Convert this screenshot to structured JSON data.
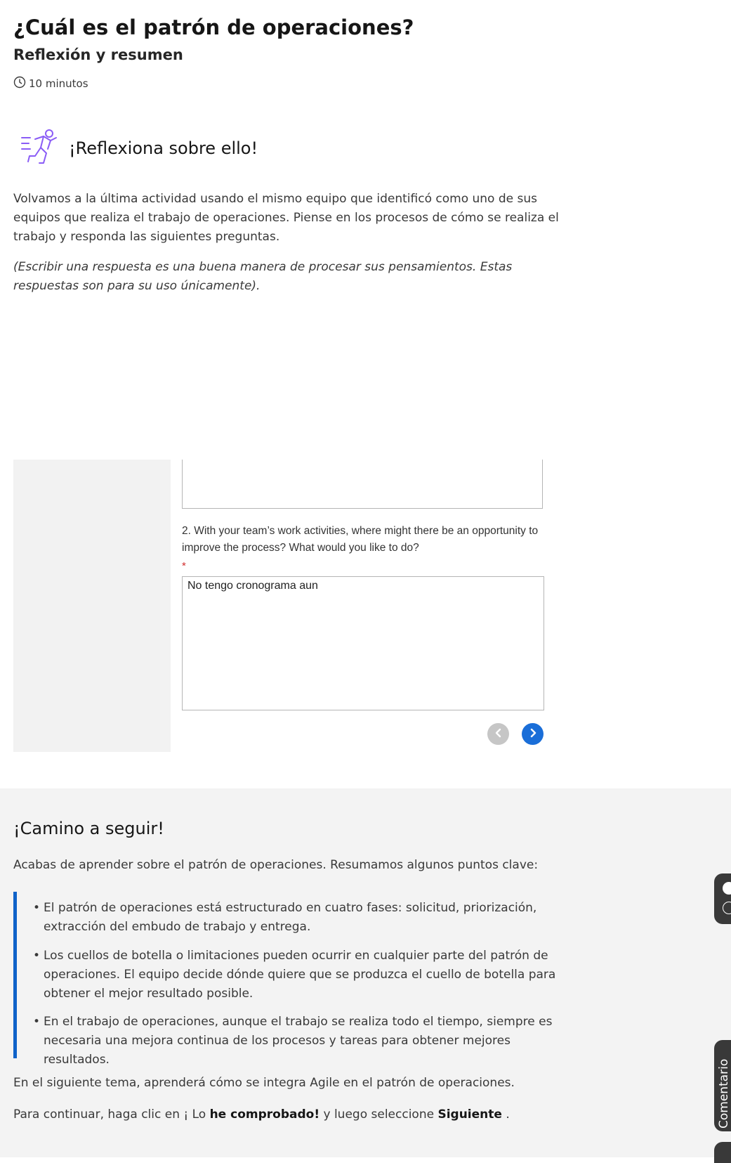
{
  "header": {
    "title": "¿Cuál es el patrón de operaciones?",
    "subtitle": "Reflexión y resumen",
    "duration": "10 minutos",
    "duration_icon": "clock-icon"
  },
  "reflect": {
    "icon": "running-person-icon",
    "heading": "¡Reflexiona sobre ello!",
    "intro": "Volvamos a la última actividad usando el mismo equipo que identificó como uno de sus equipos que realiza el trabajo de operaciones. Piense en los procesos de cómo se realiza el trabajo y responda las siguientes preguntas.",
    "note": "(Escribir una respuesta es una buena manera de procesar sus pensamientos. Estas respuestas son para su uso únicamente)."
  },
  "form": {
    "question_2": "2. With your team’s work activities, where might there be an opportunity to improve the process? What would you like to do?",
    "required_mark": "*",
    "answer_2": "No tengo cronograma aun",
    "prev_icon": "chevron-left-icon",
    "next_icon": "chevron-right-icon"
  },
  "summary": {
    "heading": "¡Camino a seguir!",
    "intro": "Acabas de aprender sobre el patrón de operaciones. Resumamos algunos puntos clave:",
    "bullets": [
      "El patrón de operaciones está estructurado en cuatro fases: solicitud, priorización, extracción del embudo de trabajo y entrega.",
      "Los cuellos de botella o limitaciones pueden ocurrir en cualquier parte del patrón de operaciones. El equipo decide dónde quiere que se produzca el cuello de botella para obtener el mejor resultado posible.",
      "En el trabajo de operaciones, aunque el trabajo se realiza todo el tiempo, siempre es necesaria una mejora continua de los procesos y tareas para obtener mejores resultados."
    ],
    "next_topic": "En el siguiente tema, aprenderá cómo se integra Agile en el patrón de operaciones.",
    "continue_prefix": "Para continuar, haga clic en ¡ Lo ",
    "continue_bold_1": "he comprobado!",
    "continue_middle": " y luego seleccione ",
    "continue_bold_2": "Siguiente",
    "continue_suffix": " ."
  },
  "side": {
    "feedback_label": "Comentario"
  },
  "colors": {
    "accent_blue": "#0f62c9",
    "nav_blue": "#1a6ed8",
    "icon_purple": "#8a5cf6",
    "summary_bg": "#f3f3f3"
  }
}
